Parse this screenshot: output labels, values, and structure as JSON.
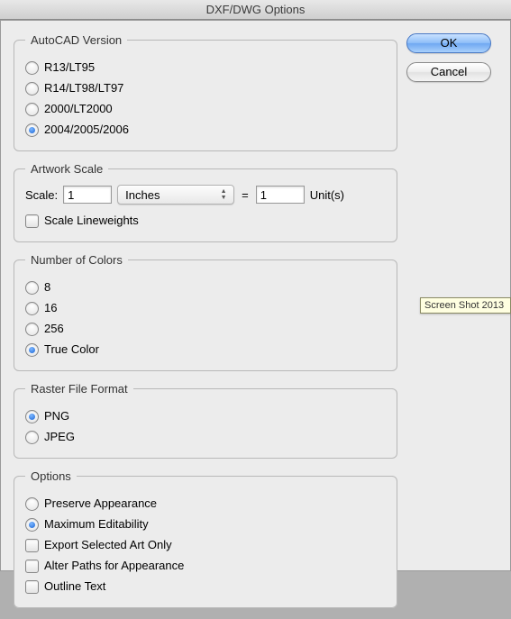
{
  "window": {
    "title": "DXF/DWG Options"
  },
  "buttons": {
    "ok": "OK",
    "cancel": "Cancel"
  },
  "autocad": {
    "legend": "AutoCAD Version",
    "options": [
      "R13/LT95",
      "R14/LT98/LT97",
      "2000/LT2000",
      "2004/2005/2006"
    ],
    "selected": 3
  },
  "artwork": {
    "legend": "Artwork Scale",
    "scale_label": "Scale:",
    "scale_value": "1",
    "unit_select": "Inches",
    "equals": "=",
    "units_value": "1",
    "units_label": "Unit(s)",
    "lineweights_label": "Scale Lineweights",
    "lineweights_checked": false
  },
  "colors": {
    "legend": "Number of Colors",
    "options": [
      "8",
      "16",
      "256",
      "True Color"
    ],
    "selected": 3
  },
  "raster": {
    "legend": "Raster File Format",
    "options": [
      "PNG",
      "JPEG"
    ],
    "selected": 0
  },
  "options": {
    "legend": "Options",
    "radios": [
      "Preserve Appearance",
      "Maximum Editability"
    ],
    "radio_selected": 1,
    "checks": [
      {
        "label": "Export Selected Art Only",
        "checked": false
      },
      {
        "label": "Alter Paths for Appearance",
        "checked": false
      },
      {
        "label": "Outline Text",
        "checked": false
      }
    ]
  },
  "tooltip": "Screen Shot 2013"
}
